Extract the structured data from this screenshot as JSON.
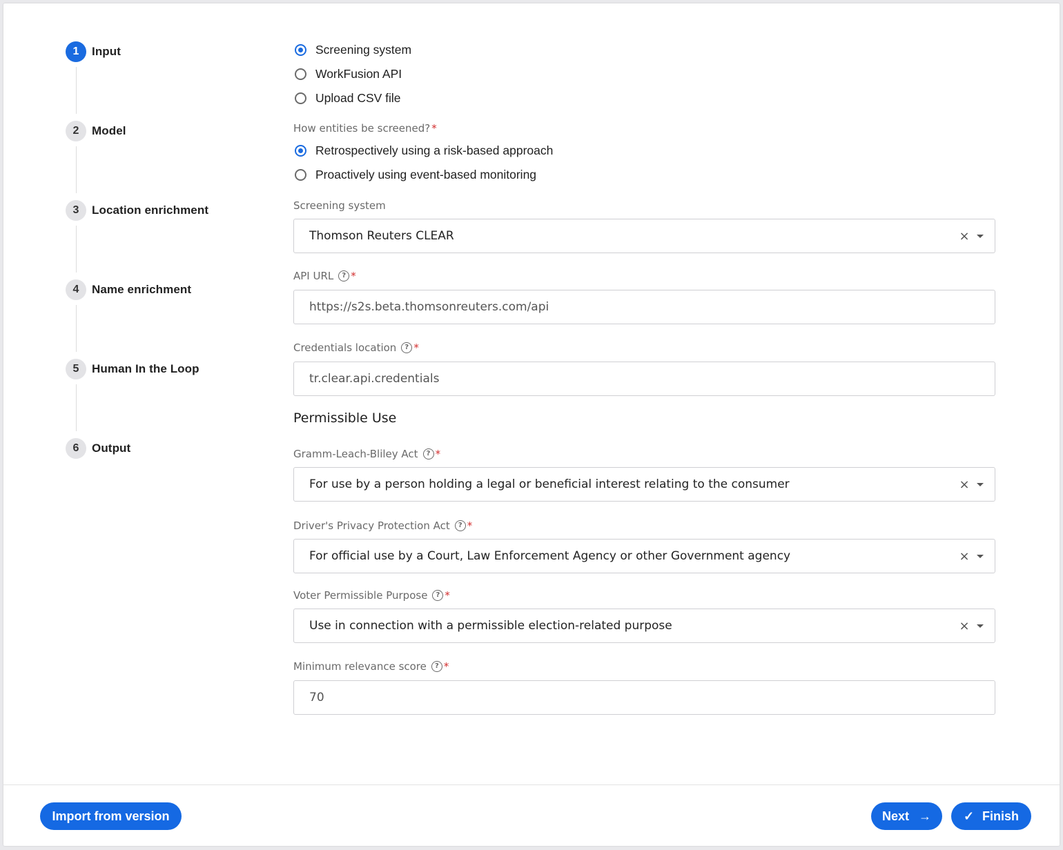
{
  "steps": [
    {
      "number": "1",
      "label": "Input",
      "active": true
    },
    {
      "number": "2",
      "label": "Model"
    },
    {
      "number": "3",
      "label": "Location enrichment"
    },
    {
      "number": "4",
      "label": "Name enrichment"
    },
    {
      "number": "5",
      "label": "Human In the Loop"
    },
    {
      "number": "6",
      "label": "Output"
    }
  ],
  "input_source": {
    "options": [
      "Screening system",
      "WorkFusion API",
      "Upload CSV file"
    ],
    "selected": "Screening system"
  },
  "screening_mode": {
    "label": "How entities be screened?",
    "required": "*",
    "options": [
      "Retrospectively using a risk-based approach",
      "Proactively using event-based monitoring"
    ],
    "selected": "Retrospectively using a risk-based approach"
  },
  "screening_system": {
    "label": "Screening system",
    "value": "Thomson Reuters CLEAR"
  },
  "api_url": {
    "label": "API URL",
    "required": "*",
    "value": "https://s2s.beta.thomsonreuters.com/api"
  },
  "credentials": {
    "label": "Credentials location",
    "required": "*",
    "value": "tr.clear.api.credentials"
  },
  "permissible_use": {
    "title": "Permissible Use",
    "glba": {
      "label": "Gramm-Leach-Bliley Act",
      "required": "*",
      "value": "For use by a person holding a legal or beneficial interest relating to the consumer"
    },
    "dppa": {
      "label": "Driver's Privacy Protection Act",
      "required": "*",
      "value": "For official use by a Court, Law Enforcement Agency or other Government agency"
    },
    "voter": {
      "label": "Voter Permissible Purpose",
      "required": "*",
      "value": "Use in connection with a permissible election-related purpose"
    }
  },
  "min_relevance": {
    "label": "Minimum relevance score",
    "required": "*",
    "value": "70"
  },
  "icons": {
    "help": "?",
    "clear": "×",
    "next_arrow": "→",
    "finish_check": "✓"
  },
  "footer": {
    "import_label": "Import from version",
    "next_label": "Next",
    "finish_label": "Finish"
  },
  "colors": {
    "primary": "#1569e3",
    "required": "#d32f2f"
  }
}
